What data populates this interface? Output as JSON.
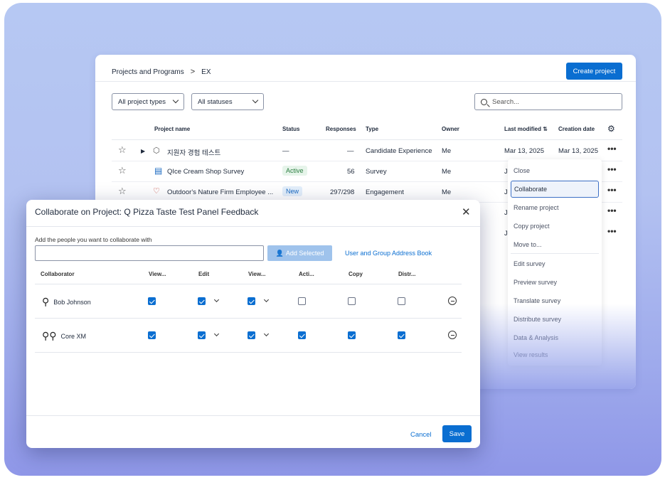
{
  "app": {
    "breadcrumb": [
      "Projects and Programs",
      "EX"
    ],
    "breadcrumb_sep": ">",
    "create_label": "Create project",
    "filters": [
      "All project types",
      "All statuses"
    ],
    "search_placeholder": "Search...",
    "columns": [
      "Project name",
      "Status",
      "Responses",
      "Type",
      "Owner",
      "Last modified ⇅",
      "Creation date"
    ],
    "rows": [
      {
        "name": "지원자 경험 테스트",
        "status": "—",
        "responses": "—",
        "type": "Candidate Experience",
        "owner": "Me",
        "modified": "Mar 13, 2025",
        "created": "Mar 13, 2025"
      },
      {
        "name": "QIce Cream Shop Survey",
        "status": "Active",
        "responses": "56",
        "type": "Survey",
        "owner": "Me",
        "modified": "J",
        "created": ""
      },
      {
        "name": "Outdoor's Nature Firm Employee ...",
        "status": "New",
        "responses": "297/298",
        "type": "Engagement",
        "owner": "Me",
        "modified": "J",
        "created": ""
      }
    ],
    "row_modified_extra": [
      "J",
      "J"
    ],
    "context_menu": [
      "Close",
      "Collaborate",
      "Rename project",
      "Copy project",
      "Move to...",
      "Edit survey",
      "Preview survey",
      "Translate survey",
      "Distribute survey",
      "Data & Analysis",
      "View results"
    ]
  },
  "modal": {
    "title": "Collaborate on Project: Q Pizza Taste Test Panel Feedback",
    "add_label": "Add the people you want to collaborate with",
    "add_button": "Add Selected",
    "address_book": "User and Group Address Book",
    "columns": [
      "Collaborator",
      "View...",
      "Edit",
      "View...",
      "Acti...",
      "Copy",
      "Distr..."
    ],
    "collaborators": [
      {
        "name": "Bob Johnson",
        "kind": "user-icon",
        "view": true,
        "edit": true,
        "view2": true,
        "activate": false,
        "copy": false,
        "distribute": false
      },
      {
        "name": "Core XM",
        "kind": "group-icon",
        "view": true,
        "edit": true,
        "view2": true,
        "activate": true,
        "copy": true,
        "distribute": true
      }
    ],
    "cancel": "Cancel",
    "save": "Save"
  },
  "colors": {
    "accent": "#0a6ed1",
    "background_gradient_top": "#b6c8f3",
    "background_gradient_bottom": "#8f97e8"
  }
}
